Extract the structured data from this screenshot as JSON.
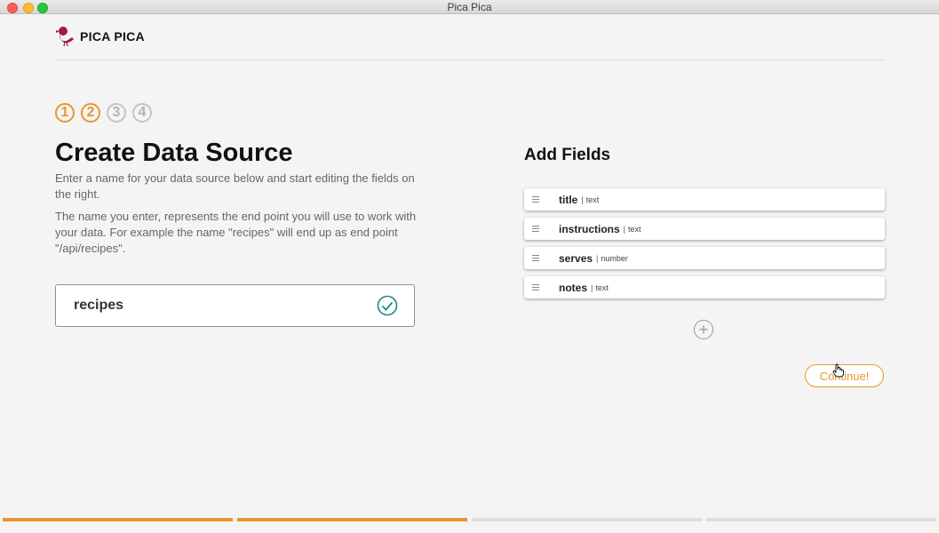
{
  "window": {
    "title": "Pica Pica"
  },
  "brand": {
    "name": "PICA PICA",
    "logo_icon": "magpie-bird-icon",
    "logo_color": "#a4174b"
  },
  "steps": [
    {
      "label": "1",
      "state": "active"
    },
    {
      "label": "2",
      "state": "active"
    },
    {
      "label": "3",
      "state": "inactive"
    },
    {
      "label": "4",
      "state": "inactive"
    }
  ],
  "main": {
    "title": "Create Data Source",
    "intro_1": "Enter a name for your data source below and start editing the fields on the right.",
    "intro_2": "The name you enter, represents the end point you will use to work with your data. For example the name \"recipes\" will end up as end point \"/api/recipes\".",
    "name_input_value": "recipes",
    "valid_icon": "check-circle-icon"
  },
  "fields_panel": {
    "title": "Add Fields",
    "fields": [
      {
        "name": "title",
        "separator": "|",
        "type": "text"
      },
      {
        "name": "instructions",
        "separator": "|",
        "type": "text"
      },
      {
        "name": "serves",
        "separator": "|",
        "type": "number"
      },
      {
        "name": "notes",
        "separator": "|",
        "type": "text"
      }
    ],
    "add_icon": "plus-circle-icon"
  },
  "actions": {
    "continue_label": "Continue!"
  },
  "progress": {
    "segments_total": 4,
    "segments_done": 2
  },
  "colors": {
    "accent": "#e8962e",
    "check": "#1e8a86",
    "brand": "#a4174b"
  }
}
